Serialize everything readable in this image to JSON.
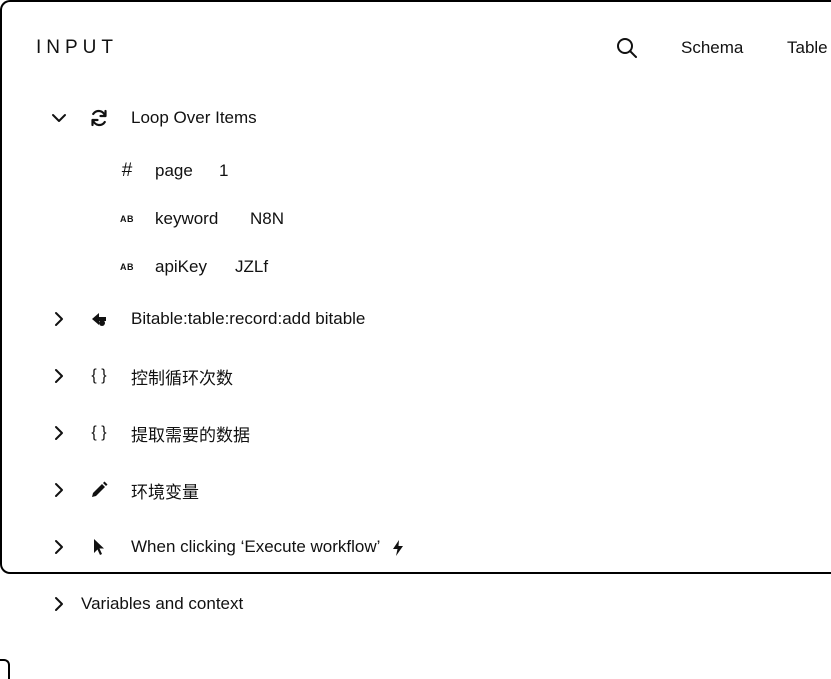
{
  "header": {
    "title": "INPUT",
    "tabs": [
      {
        "label": "Schema"
      },
      {
        "label": "Table"
      }
    ]
  },
  "icons": {
    "search": "search-icon",
    "expanded": "chevron-down-icon",
    "collapsed": "chevron-right-icon",
    "loop": "refresh-icon",
    "bitable": "bitable-logo-icon",
    "code": "braces-icon",
    "edit": "pencil-icon",
    "trigger": "cursor-pointer-icon",
    "bolt": "lightning-icon"
  },
  "tree": {
    "loop_node": {
      "label": "Loop Over Items",
      "fields": [
        {
          "type_symbol": "#",
          "name": "page",
          "value": "1"
        },
        {
          "type_symbol": "AB",
          "name": "keyword",
          "value": "N8N"
        },
        {
          "type_symbol": "AB",
          "name": "apiKey",
          "value": "JZLf"
        }
      ]
    },
    "nodes": [
      {
        "label": "Bitable:table:record:add bitable"
      },
      {
        "label": "控制循环次数",
        "icon_text": "{ }"
      },
      {
        "label": "提取需要的数据",
        "icon_text": "{ }"
      },
      {
        "label": "环境变量"
      },
      {
        "label": "When clicking ‘Execute workflow’"
      }
    ],
    "variables": {
      "label": "Variables and context"
    }
  }
}
